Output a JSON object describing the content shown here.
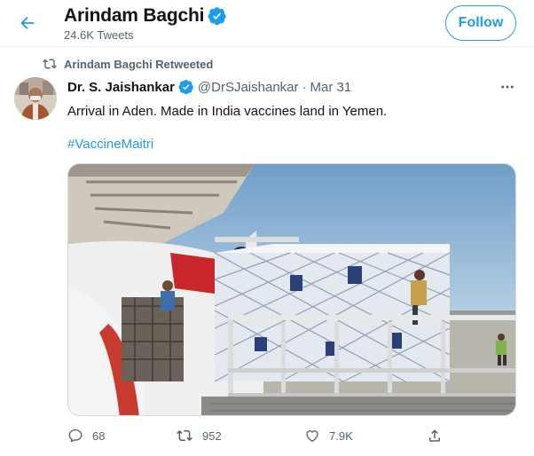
{
  "header": {
    "profile_name": "Arindam Bagchi",
    "tweet_count": "24.6K Tweets",
    "follow_label": "Follow"
  },
  "retweet": {
    "label": "Arindam Bagchi Retweeted"
  },
  "tweet": {
    "author_name": "Dr. S. Jaishankar",
    "author_handle": "@DrSJaishankar",
    "separator": "·",
    "date": "Mar 31",
    "text": "Arrival in Aden. Made in India vaccines land in Yemen.",
    "hashtag": "#VaccineMaitri",
    "stats": {
      "replies": "68",
      "retweets": "952",
      "likes": "7.9K"
    }
  },
  "colors": {
    "accent": "#1d9bf0",
    "text_primary": "#0f1419",
    "text_secondary": "#536471",
    "verified": "#1d9bf0"
  },
  "icons": [
    "back-arrow-icon",
    "verified-badge-icon",
    "retweet-icon",
    "more-icon",
    "reply-icon",
    "like-icon",
    "share-icon"
  ]
}
